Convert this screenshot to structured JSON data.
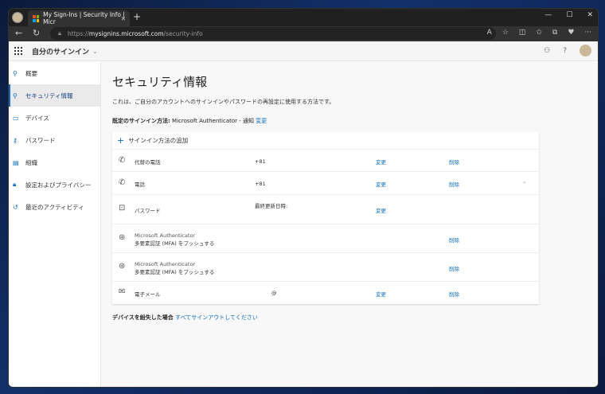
{
  "browser": {
    "tab_title": "My Sign-Ins | Security Info | Micr",
    "url_scheme": "https://",
    "url_host": "mysignins.microsoft.com",
    "url_path": "/security-info"
  },
  "header": {
    "app_title": "自分のサインイン",
    "help": "?"
  },
  "sidebar": {
    "items": [
      {
        "label": "概要",
        "icon": "person-icon"
      },
      {
        "label": "セキュリティ情報",
        "icon": "security-icon"
      },
      {
        "label": "デバイス",
        "icon": "laptop-icon"
      },
      {
        "label": "パスワード",
        "icon": "key-icon"
      },
      {
        "label": "組織",
        "icon": "briefcase-icon"
      },
      {
        "label": "設定およびプライバシー",
        "icon": "lock-icon"
      },
      {
        "label": "最近のアクティビティ",
        "icon": "history-icon"
      }
    ]
  },
  "main": {
    "title": "セキュリティ情報",
    "description": "これは、ご自分のアカウントへのサインインやパスワードの再設定に使用する方法です。",
    "default_label": "既定のサインイン方法:",
    "default_value": "Microsoft Authenticator - 通知",
    "default_change": "変更",
    "add_method": "サインイン方法の追加",
    "methods": [
      {
        "name": "代替の電話",
        "value": "+81",
        "change": "変更",
        "delete": "削除"
      },
      {
        "name": "電話",
        "value": "+81",
        "change": "変更",
        "delete": "削除"
      },
      {
        "name": "パスワード",
        "value": "最終更新日時:",
        "change": "変更"
      },
      {
        "name": "Microsoft Authenticator",
        "sub": "多要素認証 (MFA) をプッシュする",
        "delete": "削除"
      },
      {
        "name": "Microsoft Authenticator",
        "sub": "多要素認証 (MFA) をプッシュする",
        "delete": "削除"
      },
      {
        "name": "電子メール",
        "value": "@",
        "change": "変更",
        "delete": "削除"
      }
    ],
    "lost_label": "デバイスを紛失した場合",
    "lost_link": "すべてサインアウトしてください"
  }
}
